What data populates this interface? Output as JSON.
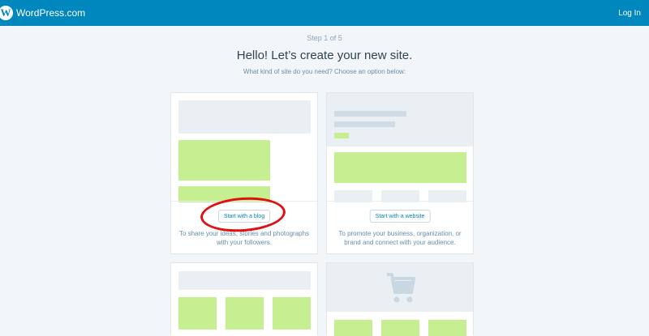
{
  "header": {
    "brand": "WordPress.com",
    "login_label": "Log In",
    "color": "#0087be"
  },
  "intro": {
    "step": "Step 1 of 5",
    "title": "Hello! Let’s create your new site.",
    "subtitle": "What kind of site do you need? Choose an option below:"
  },
  "cards": [
    {
      "button": "Start with a blog",
      "description_line1": "To share your ideas, stories and photographs",
      "description_line2": "with your followers."
    },
    {
      "button": "Start with a website",
      "description_line1": "To promote your business, organization, or",
      "description_line2": "brand and connect with your audience."
    }
  ],
  "icons": {
    "logo": "wordpress-logo-icon",
    "cart": "shopping-cart-icon"
  },
  "colors": {
    "placeholder_green": "#c5ef91",
    "placeholder_grey": "#e9eff3",
    "annotation": "#e01010"
  }
}
